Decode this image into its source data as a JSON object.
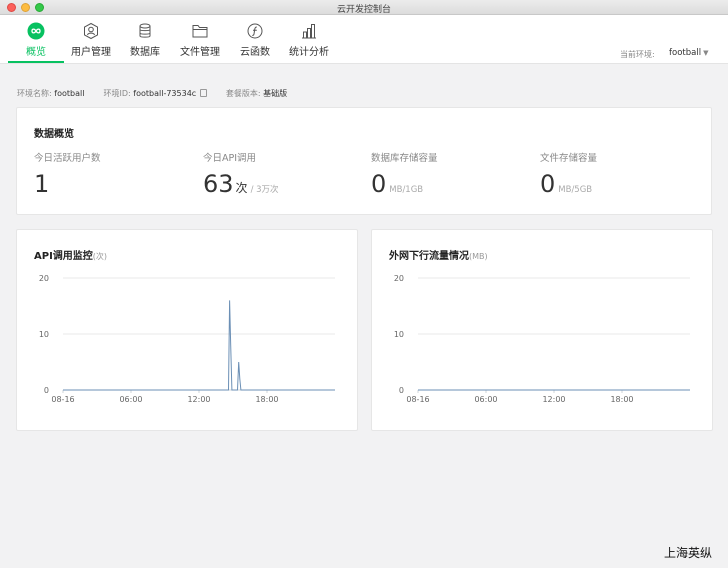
{
  "window": {
    "title": "云开发控制台"
  },
  "nav": {
    "items": [
      {
        "label": "概览",
        "icon": "infinity-icon"
      },
      {
        "label": "用户管理",
        "icon": "user-icon"
      },
      {
        "label": "数据库",
        "icon": "database-icon"
      },
      {
        "label": "文件管理",
        "icon": "folder-icon"
      },
      {
        "label": "云函数",
        "icon": "function-icon"
      },
      {
        "label": "统计分析",
        "icon": "bar-chart-icon"
      }
    ],
    "active_index": 0,
    "env_label": "当前环境:",
    "env_value": "football"
  },
  "info": {
    "env_name_label": "环境名称:",
    "env_name": "football",
    "env_id_label": "环境ID:",
    "env_id": "football-73534c",
    "plan_label": "套餐版本:",
    "plan": "基础版"
  },
  "overview": {
    "title": "数据概览",
    "stats": [
      {
        "label": "今日活跃用户数",
        "value": "1",
        "unit": "",
        "unit2": ""
      },
      {
        "label": "今日API调用",
        "value": "63",
        "unit": "次",
        "unit2": "/ 3万次"
      },
      {
        "label": "数据库存储容量",
        "value": "0",
        "unit": "",
        "unit2": "MB/1GB"
      },
      {
        "label": "文件存储容量",
        "value": "0",
        "unit": "",
        "unit2": "MB/5GB"
      }
    ]
  },
  "colors": {
    "accent": "#07c160",
    "series": "#6b8fb5",
    "grid": "#e8e8e8"
  },
  "chart_data": [
    {
      "type": "line",
      "title": "API调用监控",
      "unit": "(次)",
      "x_ticks": [
        "08-16",
        "06:00",
        "12:00",
        "18:00"
      ],
      "x_range_hours": [
        0,
        24
      ],
      "y_ticks": [
        "0",
        "10",
        "20"
      ],
      "ylim": [
        0,
        20
      ],
      "points": [
        [
          0,
          0
        ],
        [
          14.6,
          0
        ],
        [
          14.7,
          16
        ],
        [
          14.8,
          8
        ],
        [
          14.9,
          0
        ],
        [
          15.4,
          0
        ],
        [
          15.5,
          5
        ],
        [
          15.6,
          2
        ],
        [
          15.7,
          0
        ],
        [
          24,
          0
        ]
      ]
    },
    {
      "type": "line",
      "title": "外网下行流量情况",
      "unit": "(MB)",
      "x_ticks": [
        "08-16",
        "06:00",
        "12:00",
        "18:00"
      ],
      "x_range_hours": [
        0,
        24
      ],
      "y_ticks": [
        "0",
        "10",
        "20"
      ],
      "ylim": [
        0,
        20
      ],
      "points": [
        [
          0,
          0
        ],
        [
          24,
          0
        ]
      ]
    }
  ],
  "watermark": "上海英纵"
}
